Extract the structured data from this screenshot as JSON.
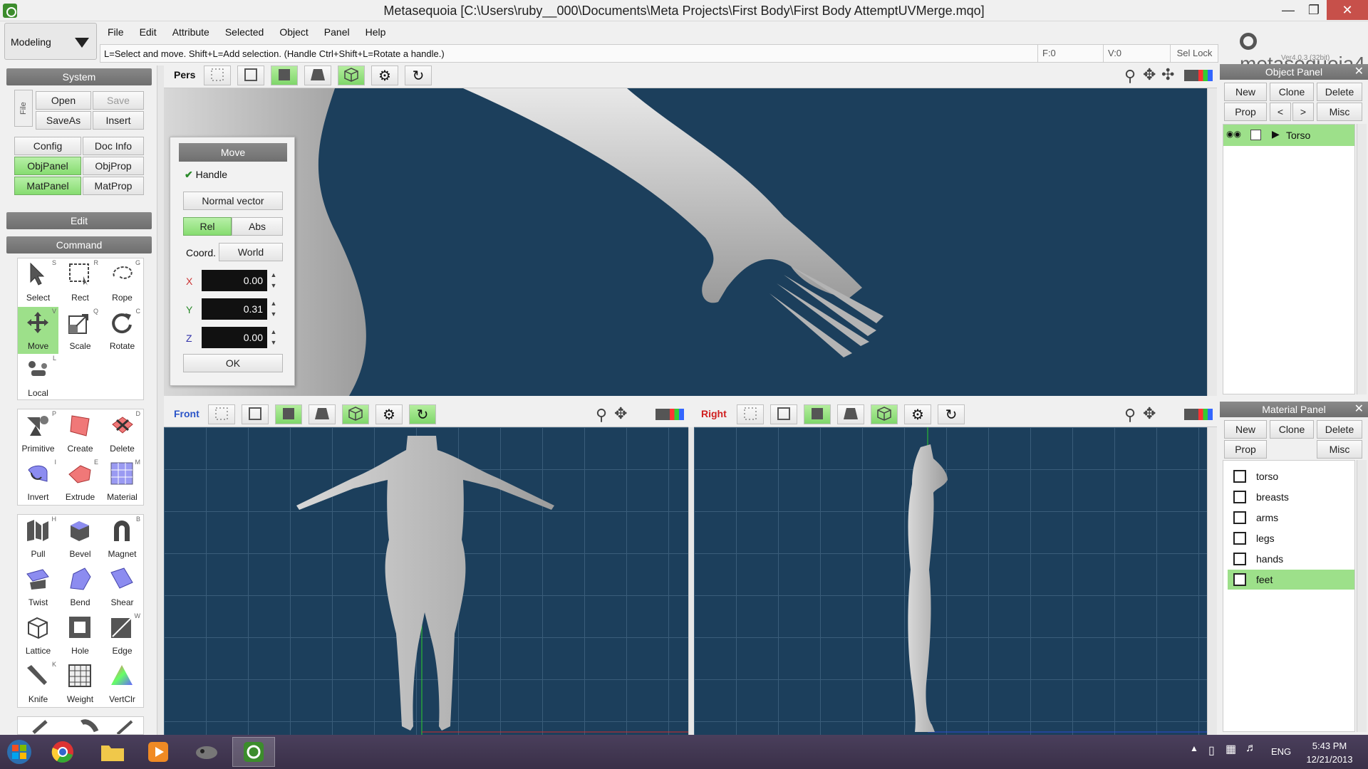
{
  "window": {
    "title": "Metasequoia [C:\\Users\\ruby__000\\Documents\\Meta Projects\\First Body\\First Body AttemptUVMerge.mqo]"
  },
  "mode": {
    "selected": "Modeling"
  },
  "menu": [
    "File",
    "Edit",
    "Attribute",
    "Selected",
    "Object",
    "Panel",
    "Help"
  ],
  "hint": "L=Select and move.  Shift+L=Add selection.  (Handle Ctrl+Shift+L=Rotate a handle.)",
  "status": {
    "f": "F:0",
    "v": "V:0",
    "sel_lock": "Sel Lock"
  },
  "logo": {
    "name": "metasequoia4",
    "version": "Ver4.0.3 (32bit)"
  },
  "system": {
    "title": "System",
    "file_tab": "File",
    "open": "Open",
    "save": "Save",
    "saveas": "SaveAs",
    "insert": "Insert",
    "config": "Config",
    "docinfo": "Doc Info",
    "objpanel": "ObjPanel",
    "objprop": "ObjProp",
    "matpanel": "MatPanel",
    "matprop": "MatProp"
  },
  "edit_title": "Edit",
  "command_title": "Command",
  "tools": [
    {
      "label": "Select",
      "key": "S"
    },
    {
      "label": "Rect",
      "key": "R"
    },
    {
      "label": "Rope",
      "key": "G"
    },
    {
      "label": "Move",
      "key": "V"
    },
    {
      "label": "Scale",
      "key": "Q"
    },
    {
      "label": "Rotate",
      "key": "C"
    },
    {
      "label": "Local",
      "key": "L"
    },
    {
      "label": "Primitive",
      "key": "P"
    },
    {
      "label": "Create",
      "key": ""
    },
    {
      "label": "Delete",
      "key": "D"
    },
    {
      "label": "Invert",
      "key": "I"
    },
    {
      "label": "Extrude",
      "key": "E"
    },
    {
      "label": "Material",
      "key": "M"
    },
    {
      "label": "Pull",
      "key": "H"
    },
    {
      "label": "Bevel",
      "key": ""
    },
    {
      "label": "Magnet",
      "key": "B"
    },
    {
      "label": "Twist",
      "key": ""
    },
    {
      "label": "Bend",
      "key": ""
    },
    {
      "label": "Shear",
      "key": ""
    },
    {
      "label": "Lattice",
      "key": ""
    },
    {
      "label": "Hole",
      "key": ""
    },
    {
      "label": "Edge",
      "key": "W"
    },
    {
      "label": "Knife",
      "key": "K"
    },
    {
      "label": "Weight",
      "key": ""
    },
    {
      "label": "VertClr",
      "key": ""
    }
  ],
  "viewports": {
    "pers": "Pers",
    "front": "Front",
    "right": "Right"
  },
  "move_panel": {
    "title": "Move",
    "handle": "Handle",
    "normal_vector": "Normal vector",
    "rel": "Rel",
    "abs": "Abs",
    "coord": "Coord.",
    "world": "World",
    "x_label": "X",
    "y_label": "Y",
    "z_label": "Z",
    "x": "0.00",
    "y": "0.31",
    "z": "0.00",
    "ok": "OK"
  },
  "object_panel": {
    "title": "Object Panel",
    "new": "New",
    "clone": "Clone",
    "delete": "Delete",
    "prop": "Prop",
    "prev": "<",
    "next": ">",
    "misc": "Misc",
    "objects": [
      {
        "name": "Torso"
      }
    ]
  },
  "material_panel": {
    "title": "Material Panel",
    "new": "New",
    "clone": "Clone",
    "delete": "Delete",
    "prop": "Prop",
    "misc": "Misc",
    "materials": [
      "torso",
      "breasts",
      "arms",
      "legs",
      "hands",
      "feet"
    ],
    "selected": "feet"
  },
  "taskbar": {
    "lang": "ENG",
    "time": "5:43 PM",
    "date": "12/21/2013"
  },
  "colors": {
    "viewport_bg": "#1c3f5c",
    "active_green": "#9de08a",
    "taskbar": "#433a55"
  }
}
